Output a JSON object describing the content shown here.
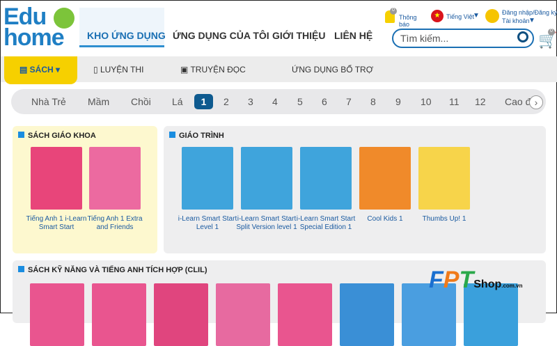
{
  "logo": {
    "line1": "Edu",
    "line2": "home"
  },
  "nav": [
    "KHO ỨNG DỤNG",
    "ỨNG DỤNG CỦA TÔI",
    "GIỚI THIỆU",
    "LIÊN HỆ"
  ],
  "top": {
    "notif_label": "Thông báo",
    "notif_count": "0",
    "language": "Tiếng Việt",
    "login": "Đăng nhập/Đăng ký",
    "account": "Tài khoản",
    "cart_count": "0"
  },
  "search": {
    "placeholder": "Tìm kiếm..."
  },
  "subnav": [
    "SÁCH",
    "LUYỆN THI",
    "TRUYỆN ĐỌC",
    "ỨNG DỤNG BỔ TRỢ"
  ],
  "grades": [
    "Nhà Trẻ",
    "Mầm",
    "Chồi",
    "Lá",
    "1",
    "2",
    "3",
    "4",
    "5",
    "6",
    "7",
    "8",
    "9",
    "10",
    "11",
    "12",
    "Cao đ"
  ],
  "selected_grade": "1",
  "sgk": {
    "title": "SÁCH GIÁO KHOA",
    "books": [
      {
        "title": "Tiếng Anh 1 i-Learn Smart Start",
        "color": "#e8457a"
      },
      {
        "title": "Tiếng Anh 1 Extra and Friends",
        "color": "#ec6aa0"
      }
    ]
  },
  "giaotrinh": {
    "title": "GIÁO TRÌNH",
    "books": [
      {
        "title": "i-Learn Smart Start Level 1",
        "color": "#3fa4dc"
      },
      {
        "title": "i-Learn Smart Start Split Version level 1",
        "color": "#3fa4dc"
      },
      {
        "title": "i-Learn Smart Start Special Edition 1",
        "color": "#3fa4dc"
      },
      {
        "title": "Cool Kids 1",
        "color": "#f08a2a"
      },
      {
        "title": "Thumbs Up! 1",
        "color": "#f7d44a"
      }
    ]
  },
  "clil": {
    "title": "SÁCH KỸ NĂNG VÀ TIẾNG ANH TÍCH HỢP (CLIL)",
    "colors": [
      "#e9558f",
      "#e9558f",
      "#e0457e",
      "#e76aa0",
      "#e9558f",
      "#3a8fd6",
      "#4a9ee0",
      "#3aa0dc"
    ]
  },
  "watermark": {
    "brand": "FPT",
    "suffix": "Shop",
    "domain": ".com.vn"
  }
}
